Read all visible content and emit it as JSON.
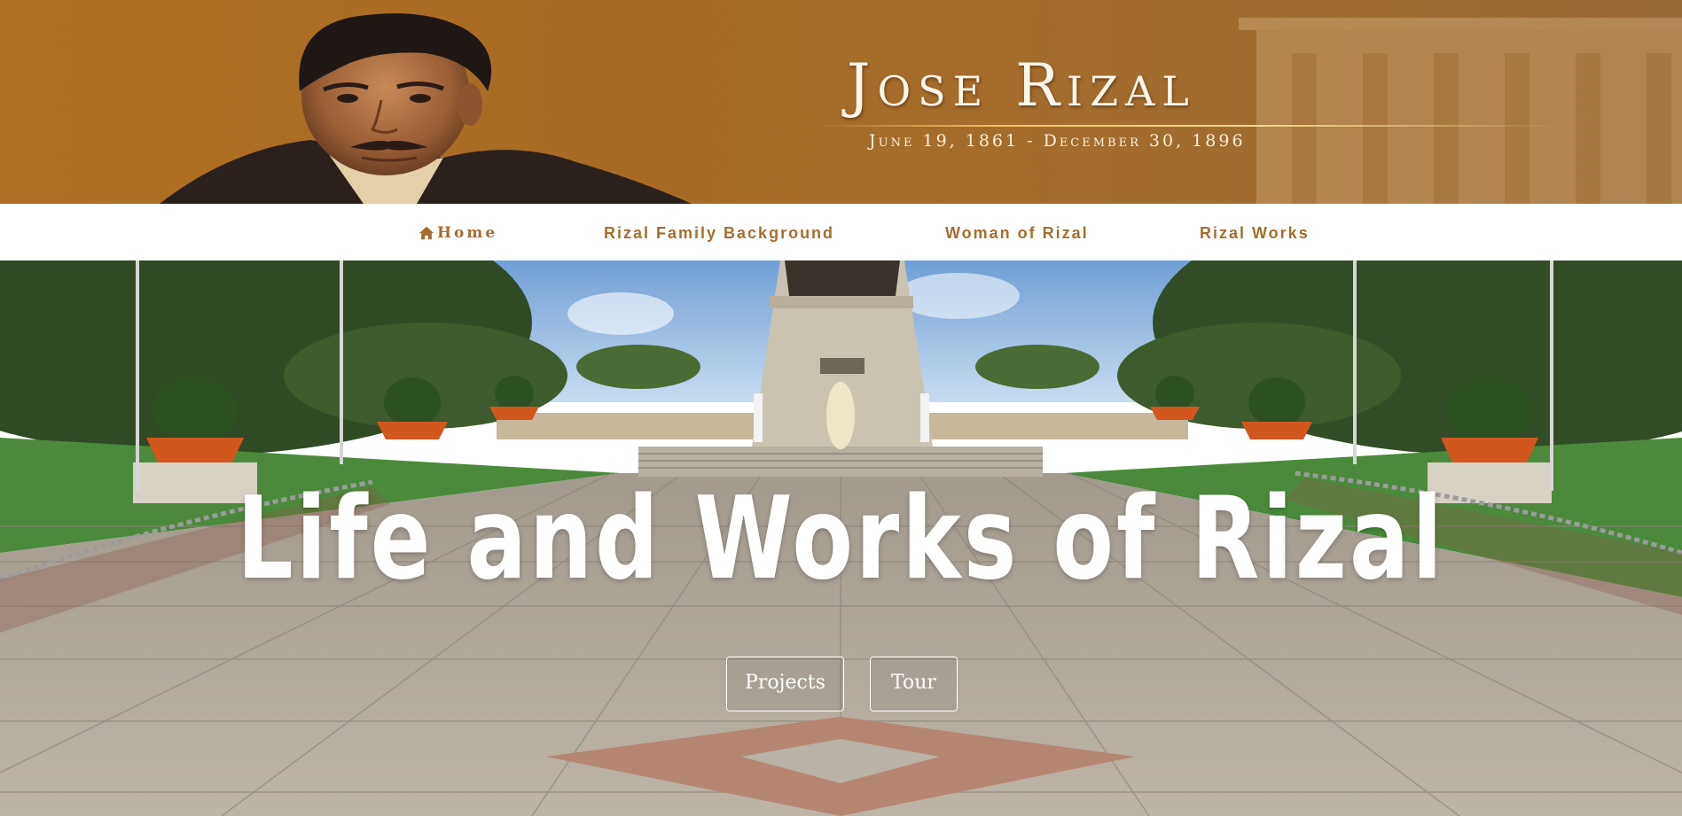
{
  "banner": {
    "title": "Jose Rizal",
    "dates": "June 19, 1861 - December 30, 1896"
  },
  "nav": {
    "items": [
      {
        "label": "Home",
        "icon": "home-icon"
      },
      {
        "label": "Rizal Family Background"
      },
      {
        "label": "Woman of Rizal"
      },
      {
        "label": "Rizal Works"
      }
    ]
  },
  "hero": {
    "heading": "Life and Works of Rizal",
    "buttons": [
      {
        "label": "Projects"
      },
      {
        "label": "Tour"
      }
    ]
  },
  "colors": {
    "banner_brown": "#a86b25",
    "nav_text": "#a66d2e",
    "hero_text": "#ffffff"
  }
}
